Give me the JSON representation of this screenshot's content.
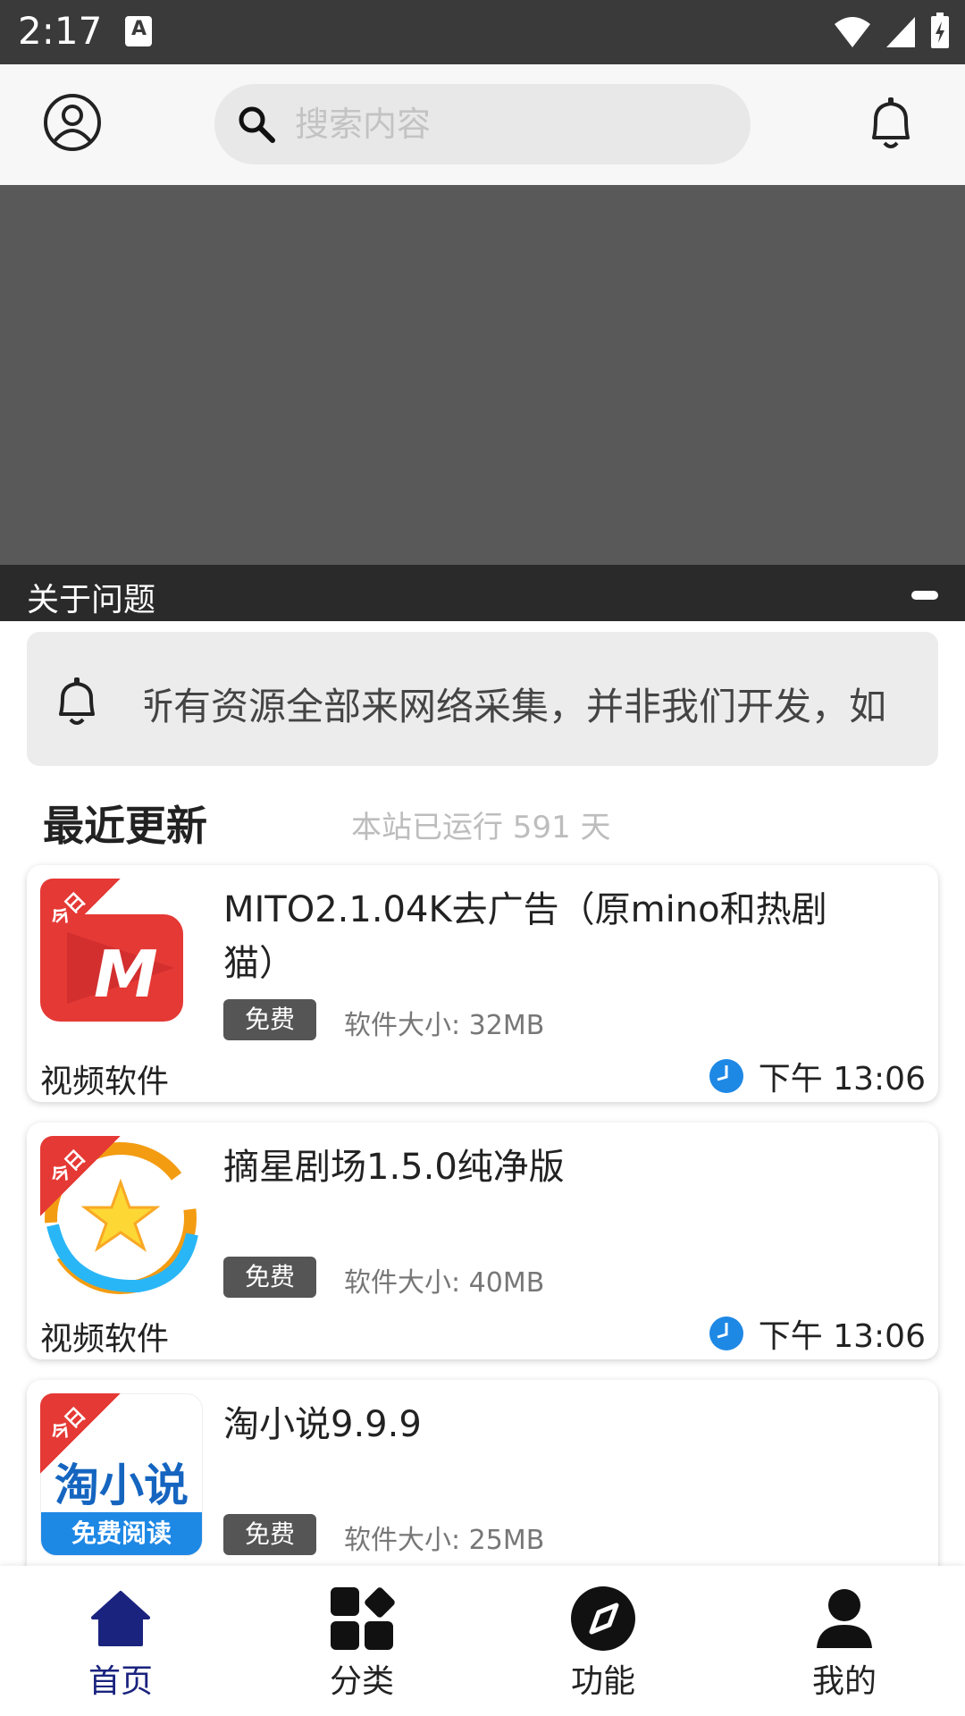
{
  "status_bar": {
    "time": "2:17"
  },
  "header": {
    "search_placeholder": "搜索内容"
  },
  "banner": {
    "caption": "关于问题"
  },
  "notice": {
    "text": "所有资源全部来网络采集，并非我们开发，如"
  },
  "section": {
    "title": "最近更新",
    "running_days": "本站已运行 591 天"
  },
  "cards": [
    {
      "ribbon": "今日",
      "name": "MITO2.1.04K去广告（原mino和热剧猫）",
      "tag": "免费",
      "size": "软件大小: 32MB",
      "category": "视频软件",
      "time": "下午 13:06"
    },
    {
      "ribbon": "今日",
      "name": "摘星剧场1.5.0纯净版",
      "tag": "免费",
      "size": "软件大小: 40MB",
      "category": "视频软件",
      "time": "下午 13:06"
    },
    {
      "ribbon": "今日",
      "name": "淘小说9.9.9",
      "tag": "免费",
      "size": "软件大小: 25MB",
      "category": "",
      "time": "",
      "thumb_text": "淘小说",
      "thumb_sub": "免费阅读"
    }
  ],
  "nav": [
    {
      "label": "首页",
      "icon": "home-icon"
    },
    {
      "label": "分类",
      "icon": "category-icon"
    },
    {
      "label": "功能",
      "icon": "compass-icon"
    },
    {
      "label": "我的",
      "icon": "person-icon"
    }
  ],
  "colors": {
    "accent": "#1a237e",
    "ribbon": "#e53935",
    "clock": "#1e88e5"
  }
}
